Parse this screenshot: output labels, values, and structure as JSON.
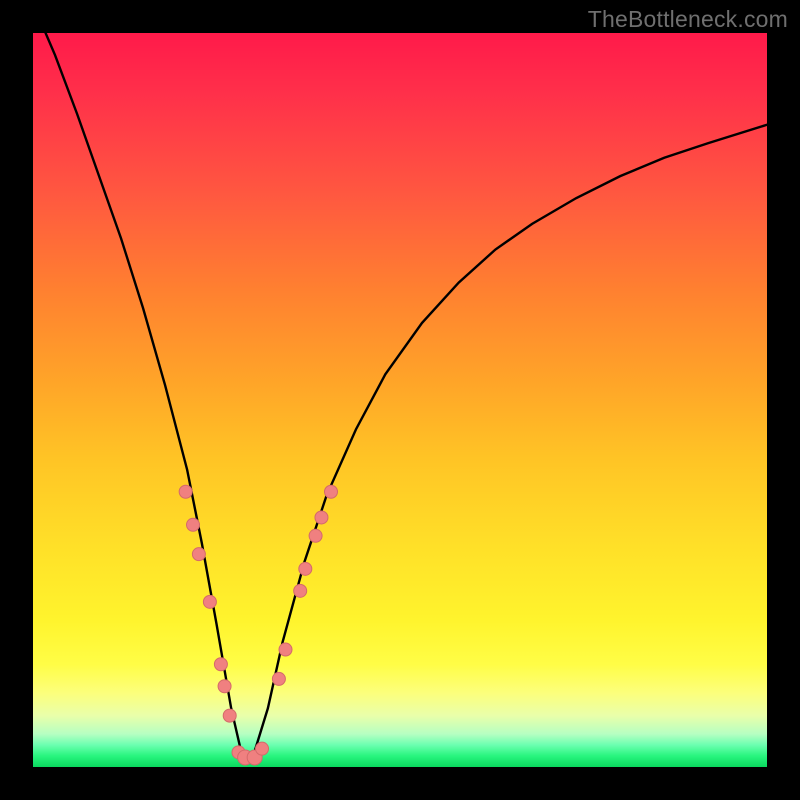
{
  "watermark": "TheBottleneck.com",
  "chart_data": {
    "type": "line",
    "title": "",
    "xlabel": "",
    "ylabel": "",
    "xlim": [
      0,
      100
    ],
    "ylim": [
      0,
      100
    ],
    "x": [
      0,
      3,
      6,
      9,
      12,
      15,
      18,
      21,
      23,
      25,
      27,
      28.5,
      30,
      32,
      34,
      37,
      40,
      44,
      48,
      53,
      58,
      63,
      68,
      74,
      80,
      86,
      92,
      100
    ],
    "series": [
      {
        "name": "bottleneck-curve",
        "values": [
          104,
          97,
          89,
          80.5,
          72,
          62.5,
          52,
          40.5,
          30.5,
          19.5,
          8,
          1.5,
          1.5,
          8,
          17,
          28,
          37,
          46,
          53.5,
          60.5,
          66,
          70.5,
          74,
          77.5,
          80.5,
          83,
          85,
          87.5
        ]
      }
    ],
    "markers": {
      "left": [
        {
          "x": 20.8,
          "y": 37.5
        },
        {
          "x": 21.8,
          "y": 33
        },
        {
          "x": 22.6,
          "y": 29
        },
        {
          "x": 24.1,
          "y": 22.5
        },
        {
          "x": 25.6,
          "y": 14
        },
        {
          "x": 26.1,
          "y": 11
        },
        {
          "x": 26.8,
          "y": 7
        },
        {
          "x": 28.0,
          "y": 2
        }
      ],
      "bottom": [
        {
          "x": 28.9,
          "y": 1.3
        },
        {
          "x": 30.2,
          "y": 1.3
        }
      ],
      "right": [
        {
          "x": 31.2,
          "y": 2.5
        },
        {
          "x": 33.5,
          "y": 12
        },
        {
          "x": 34.4,
          "y": 16
        },
        {
          "x": 36.4,
          "y": 24
        },
        {
          "x": 37.1,
          "y": 27
        },
        {
          "x": 38.5,
          "y": 31.5
        },
        {
          "x": 39.3,
          "y": 34
        },
        {
          "x": 40.6,
          "y": 37.5
        }
      ]
    },
    "colors": {
      "curve": "#000000",
      "marker_fill": "#f08080",
      "marker_stroke": "#d46a6a"
    }
  }
}
